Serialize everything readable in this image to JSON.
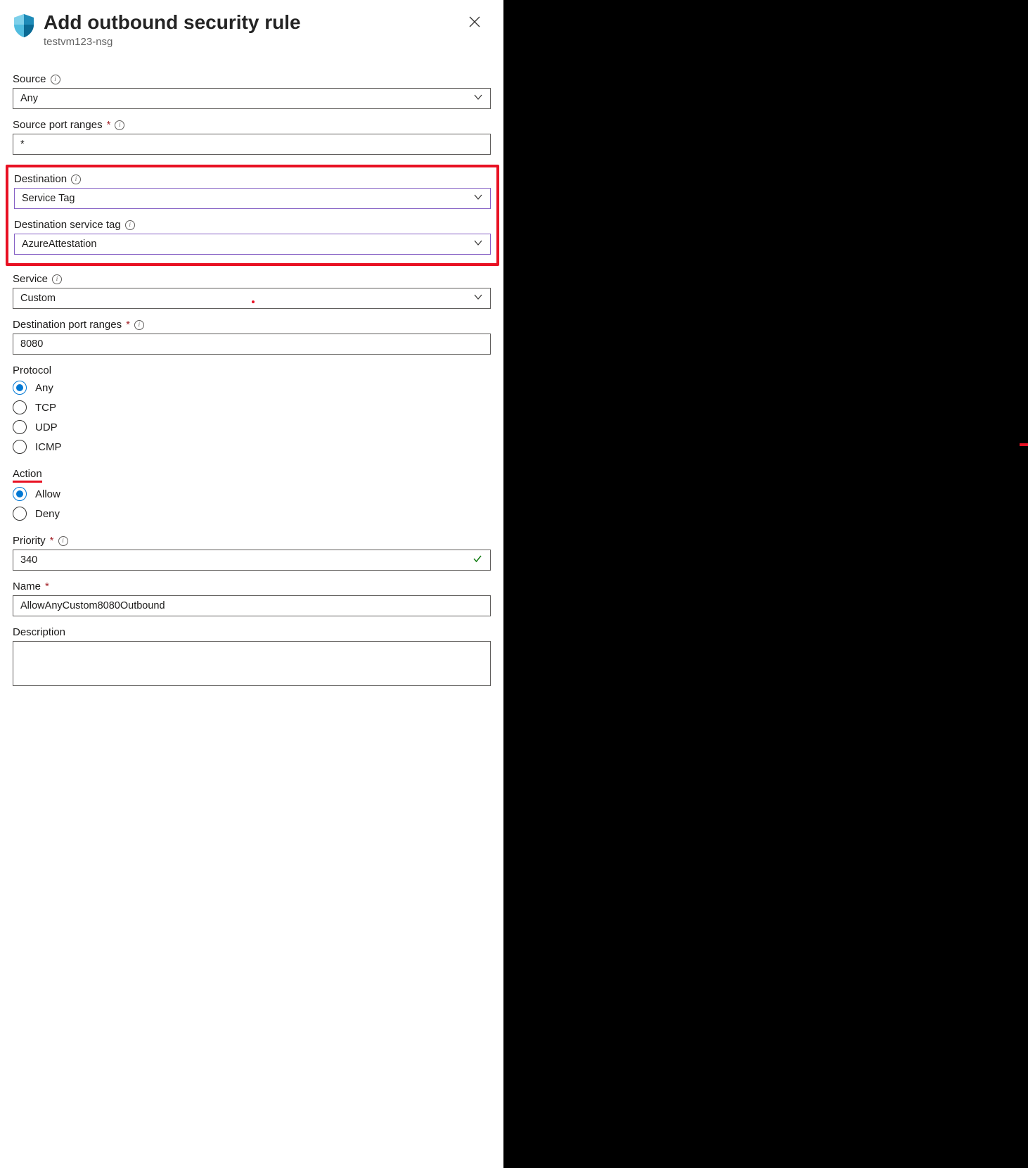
{
  "header": {
    "title": "Add outbound security rule",
    "subtitle": "testvm123-nsg"
  },
  "source": {
    "label": "Source",
    "value": "Any"
  },
  "sourcePortRanges": {
    "label": "Source port ranges",
    "value": "*"
  },
  "destination": {
    "label": "Destination",
    "value": "Service Tag"
  },
  "destinationServiceTag": {
    "label": "Destination service tag",
    "value": "AzureAttestation"
  },
  "service": {
    "label": "Service",
    "value": "Custom"
  },
  "destinationPortRanges": {
    "label": "Destination port ranges",
    "value": "8080"
  },
  "protocol": {
    "label": "Protocol",
    "options": [
      "Any",
      "TCP",
      "UDP",
      "ICMP"
    ],
    "selected": "Any"
  },
  "action": {
    "label": "Action",
    "options": [
      "Allow",
      "Deny"
    ],
    "selected": "Allow"
  },
  "priority": {
    "label": "Priority",
    "value": "340"
  },
  "name": {
    "label": "Name",
    "value": "AllowAnyCustom8080Outbound"
  },
  "description": {
    "label": "Description",
    "value": ""
  }
}
